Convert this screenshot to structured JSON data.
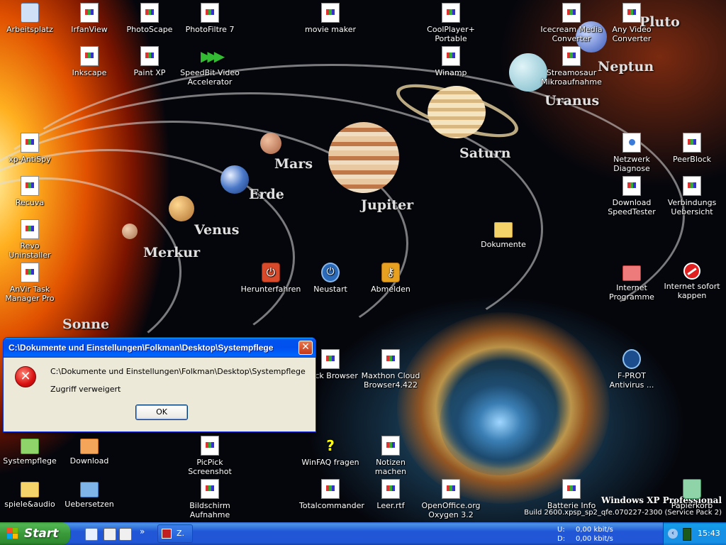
{
  "wallpaper": {
    "planets": [
      "Pluto",
      "Neptun",
      "Uranus",
      "Saturn",
      "Mars",
      "Erde",
      "Jupiter",
      "Venus",
      "Merkur",
      "Sonne"
    ],
    "os_name": "Windows XP Professional",
    "os_build": "Build 2600.xpsp_sp2_qfe.070227-2300 (Service Pack 2)"
  },
  "desktop_icons": [
    {
      "label": "Arbeitsplatz",
      "icon": "my-computer-icon"
    },
    {
      "label": "IrfanView",
      "icon": "file-icon"
    },
    {
      "label": "PhotoScape",
      "icon": "file-icon"
    },
    {
      "label": "PhotoFiltre 7",
      "icon": "file-icon"
    },
    {
      "label": "movie maker",
      "icon": "file-icon"
    },
    {
      "label": "CoolPlayer+ Portable",
      "icon": "file-icon"
    },
    {
      "label": "Icecream Media Converter",
      "icon": "file-icon"
    },
    {
      "label": "Any Video Converter",
      "icon": "file-icon"
    },
    {
      "label": "Inkscape",
      "icon": "file-icon"
    },
    {
      "label": "Paint XP",
      "icon": "file-icon"
    },
    {
      "label": "SpeedBit Video Accelerator",
      "icon": "speedbit-icon"
    },
    {
      "label": "Winamp",
      "icon": "file-icon"
    },
    {
      "label": "Streamosaur Mikroaufnahme",
      "icon": "file-icon"
    },
    {
      "label": "xp-AntiSpy",
      "icon": "file-icon"
    },
    {
      "label": "Netzwerk Diagnose",
      "icon": "network-diagnose-icon"
    },
    {
      "label": "PeerBlock",
      "icon": "file-icon"
    },
    {
      "label": "Recuva",
      "icon": "file-icon"
    },
    {
      "label": "Download SpeedTester",
      "icon": "file-icon"
    },
    {
      "label": "Verbindungs Uebersicht",
      "icon": "file-icon"
    },
    {
      "label": "Revo Uninstaller",
      "icon": "file-icon"
    },
    {
      "label": "Dokumente",
      "icon": "folder-icon"
    },
    {
      "label": "AnVir Task Manager Pro",
      "icon": "file-icon"
    },
    {
      "label": "Herunterfahren",
      "icon": "shutdown-icon"
    },
    {
      "label": "Neustart",
      "icon": "restart-icon"
    },
    {
      "label": "Abmelden",
      "icon": "logoff-key-icon"
    },
    {
      "label": "Internet Programme",
      "icon": "red-folder-icon"
    },
    {
      "label": "Internet sofort kappen",
      "icon": "no-entry-icon"
    },
    {
      "label": "...ock Browser",
      "icon": "file-icon"
    },
    {
      "label": "Maxthon Cloud Browser4.422",
      "icon": "file-icon"
    },
    {
      "label": "F-PROT Antivirus ...",
      "icon": "fprot-icon"
    },
    {
      "label": "Systempflege",
      "icon": "green-folder-icon"
    },
    {
      "label": "Download",
      "icon": "orange-folder-icon"
    },
    {
      "label": "PicPick Screenshot",
      "icon": "file-icon"
    },
    {
      "label": "WinFAQ fragen",
      "icon": "help-question-icon"
    },
    {
      "label": "Notizen machen",
      "icon": "file-icon"
    },
    {
      "label": "spiele&audio",
      "icon": "folder-icon"
    },
    {
      "label": "Uebersetzen",
      "icon": "blue-folder-icon"
    },
    {
      "label": "Bildschirm Aufnahme",
      "icon": "file-icon"
    },
    {
      "label": "Totalcommander",
      "icon": "file-icon"
    },
    {
      "label": "Leer.rtf",
      "icon": "rtf-document-icon"
    },
    {
      "label": "OpenOffice.org Oxygen 3.2",
      "icon": "file-icon"
    },
    {
      "label": "Batterie Info",
      "icon": "file-icon"
    },
    {
      "label": "Papierkorb",
      "icon": "recycle-bin-icon"
    }
  ],
  "dialog": {
    "title": "C:\\Dokumente und Einstellungen\\Folkman\\Desktop\\Systempflege",
    "path": "C:\\Dokumente und Einstellungen\\Folkman\\Desktop\\Systempflege",
    "message": "Zugriff verweigert",
    "ok_label": "OK",
    "close_glyph": "✕",
    "error_glyph": "✕"
  },
  "taskbar": {
    "start_label": "Start",
    "quicklaunch_more": "»",
    "task_label": "Z.",
    "network": {
      "up_label": "U:",
      "up_value": "0,00 kbit/s",
      "down_label": "D:",
      "down_value": "0,00 kbit/s"
    },
    "tray_chevron": "‹",
    "clock": "15:43"
  },
  "colors": {
    "taskbar_blue": "#2157d7",
    "start_green": "#3a9a3a",
    "dialog_face": "#ece9d8",
    "title_blue": "#0050ee"
  }
}
